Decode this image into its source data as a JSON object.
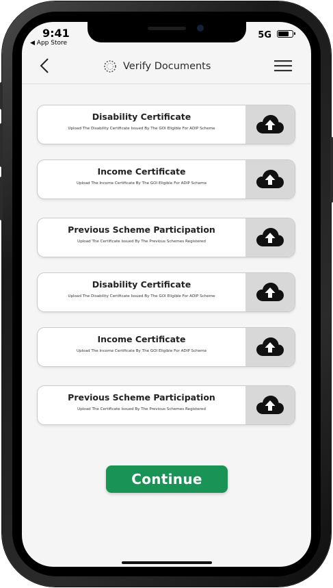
{
  "status_bar": {
    "time": "9:41",
    "back_app": "◀ App Store",
    "network": "5G",
    "battery_level": 0.8
  },
  "nav": {
    "title": "Verify Documents",
    "back_icon": "chevron-left-icon",
    "menu_icon": "hamburger-menu-icon",
    "logo_icon": "dotted-circle-logo-icon"
  },
  "documents": [
    {
      "title": "Disability Certificate",
      "description": "Upload The Disability Certificate Issued By The GOI Eligible For ADIP Scheme"
    },
    {
      "title": "Income Certificate",
      "description": "Upload The Income Certificate By The GOI Eligible For ADIP Scheme"
    },
    {
      "title": "Previous Scheme Participation",
      "description": "Upload The Certificate Issued By The Previous Schemes Registered"
    },
    {
      "title": "Disability Certificate",
      "description": "Upload The Disability Certificate Issued By The GOI Eligible For ADIP Scheme"
    },
    {
      "title": "Income Certificate",
      "description": "Upload The Income Certificate By The GOI Eligible For ADIP Scheme"
    },
    {
      "title": "Previous Scheme Participation",
      "description": "Upload The Certificate Issued By The Previous Schemes Registered"
    }
  ],
  "upload_icon": "cloud-upload-icon",
  "continue_label": "Continue",
  "colors": {
    "accent": "#1a9356",
    "screen_bg": "#f5f5f5",
    "upload_bg": "#d8d8d8"
  }
}
